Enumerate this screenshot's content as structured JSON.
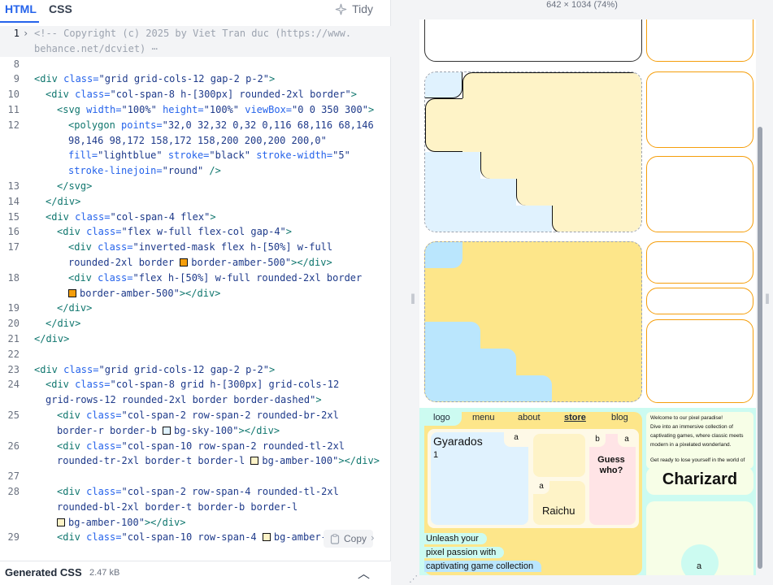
{
  "editor": {
    "tabs": {
      "html": "HTML",
      "css": "CSS"
    },
    "tidy_label": "Tidy",
    "copy_label": "Copy",
    "generated_css": {
      "title": "Generated CSS",
      "size": "2.47 kB"
    }
  },
  "code_lines": [
    {
      "num": "1",
      "fold": "›",
      "parts": [
        [
          "comment",
          "<!-- Copyright (c) 2025 by Viet Tran duc (https://www."
        ]
      ]
    },
    {
      "num": "",
      "parts": [
        [
          "comment",
          "behance.net/dcviet)"
        ],
        [
          "comment",
          " ⋯"
        ]
      ]
    },
    {
      "num": "8",
      "parts": []
    },
    {
      "num": "9",
      "parts": [
        [
          "tag",
          "<div "
        ],
        [
          "attr",
          "class="
        ],
        [
          "val",
          "\"grid grid-cols-12 gap-2 p-2\""
        ],
        [
          "tag",
          ">"
        ]
      ]
    },
    {
      "num": "10",
      "parts": [
        [
          "tag",
          "<div "
        ],
        [
          "attr",
          "class="
        ],
        [
          "val",
          "\"col-span-8 h-[300px] rounded-2xl border\""
        ],
        [
          "tag",
          ">"
        ]
      ]
    },
    {
      "num": "11",
      "parts": [
        [
          "tag",
          "<svg "
        ],
        [
          "attr",
          "width="
        ],
        [
          "val",
          "\"100%\" "
        ],
        [
          "attr",
          "height="
        ],
        [
          "val",
          "\"100%\" "
        ],
        [
          "attr",
          "viewBox="
        ],
        [
          "val",
          "\"0 0 350 300\""
        ],
        [
          "tag",
          ">"
        ]
      ]
    },
    {
      "num": "12",
      "parts": [
        [
          "tag",
          "<polygon "
        ],
        [
          "attr",
          "points="
        ],
        [
          "val",
          "\"32,0 32,32 0,32 0,116 68,116 68,146"
        ]
      ]
    },
    {
      "num": "",
      "parts": [
        [
          "val",
          "98,146 98,172 158,172 158,200 200,200 200,0\""
        ]
      ]
    },
    {
      "num": "",
      "parts": [
        [
          "attr",
          "fill="
        ],
        [
          "val",
          "\"lightblue\" "
        ],
        [
          "attr",
          "stroke="
        ],
        [
          "val",
          "\"black\" "
        ],
        [
          "attr",
          "stroke-width="
        ],
        [
          "val",
          "\"5\""
        ]
      ]
    },
    {
      "num": "",
      "parts": [
        [
          "attr",
          "stroke-linejoin="
        ],
        [
          "val",
          "\"round\" "
        ],
        [
          "tag",
          "/>"
        ]
      ]
    },
    {
      "num": "13",
      "parts": [
        [
          "tag",
          "</svg>"
        ]
      ]
    },
    {
      "num": "14",
      "parts": [
        [
          "tag",
          "</div>"
        ]
      ]
    },
    {
      "num": "15",
      "parts": [
        [
          "tag",
          "<div "
        ],
        [
          "attr",
          "class="
        ],
        [
          "val",
          "\"col-span-4 flex\""
        ],
        [
          "tag",
          ">"
        ]
      ]
    },
    {
      "num": "16",
      "parts": [
        [
          "tag",
          "<div "
        ],
        [
          "attr",
          "class="
        ],
        [
          "val",
          "\"flex w-full flex-col gap-4\""
        ],
        [
          "tag",
          ">"
        ]
      ]
    },
    {
      "num": "17",
      "parts": [
        [
          "tag",
          "<div "
        ],
        [
          "attr",
          "class="
        ],
        [
          "val",
          "\"inverted-mask flex h-[50%] w-full"
        ]
      ]
    },
    {
      "num": "",
      "parts": [
        [
          "val",
          "rounded-2xl border "
        ],
        [
          "swatch",
          "#f59e0b"
        ],
        [
          "val",
          "border-amber-500\""
        ],
        [
          "tag",
          "></div>"
        ]
      ]
    },
    {
      "num": "18",
      "parts": [
        [
          "tag",
          "<div "
        ],
        [
          "attr",
          "class="
        ],
        [
          "val",
          "\"flex h-[50%] w-full rounded-2xl border"
        ]
      ]
    },
    {
      "num": "",
      "parts": [
        [
          "swatch",
          "#f59e0b"
        ],
        [
          "val",
          "border-amber-500\""
        ],
        [
          "tag",
          "></div>"
        ]
      ]
    },
    {
      "num": "19",
      "parts": [
        [
          "tag",
          "</div>"
        ]
      ]
    },
    {
      "num": "20",
      "parts": [
        [
          "tag",
          "</div>"
        ]
      ]
    },
    {
      "num": "21",
      "parts": [
        [
          "tag",
          "</div>"
        ]
      ]
    },
    {
      "num": "22",
      "parts": []
    },
    {
      "num": "23",
      "parts": [
        [
          "tag",
          "<div "
        ],
        [
          "attr",
          "class="
        ],
        [
          "val",
          "\"grid grid-cols-12 gap-2 p-2\""
        ],
        [
          "tag",
          ">"
        ]
      ]
    },
    {
      "num": "24",
      "parts": [
        [
          "tag",
          "<div "
        ],
        [
          "attr",
          "class="
        ],
        [
          "val",
          "\"col-span-8 grid h-[300px] grid-cols-12"
        ]
      ]
    },
    {
      "num": "",
      "parts": [
        [
          "val",
          "grid-rows-12 rounded-2xl border border-dashed\""
        ],
        [
          "tag",
          ">"
        ]
      ]
    },
    {
      "num": "25",
      "parts": [
        [
          "tag",
          "<div "
        ],
        [
          "attr",
          "class="
        ],
        [
          "val",
          "\"col-span-2 row-span-2 rounded-br-2xl"
        ]
      ]
    },
    {
      "num": "",
      "parts": [
        [
          "val",
          "border-r border-b "
        ],
        [
          "swatch",
          "#e0f2fe"
        ],
        [
          "val",
          "bg-sky-100\""
        ],
        [
          "tag",
          "></div>"
        ]
      ]
    },
    {
      "num": "26",
      "parts": [
        [
          "tag",
          "<div "
        ],
        [
          "attr",
          "class="
        ],
        [
          "val",
          "\"col-span-10 row-span-2 rounded-tl-2xl"
        ]
      ]
    },
    {
      "num": "",
      "parts": [
        [
          "val",
          "rounded-tr-2xl border-t border-l "
        ],
        [
          "swatch",
          "#fef3c7"
        ],
        [
          "val",
          "bg-amber-100\""
        ],
        [
          "tag",
          "></div>"
        ]
      ]
    },
    {
      "num": "27",
      "parts": []
    },
    {
      "num": "28",
      "parts": [
        [
          "tag",
          "<div "
        ],
        [
          "attr",
          "class="
        ],
        [
          "val",
          "\"col-span-2 row-span-4 rounded-tl-2xl"
        ]
      ]
    },
    {
      "num": "",
      "parts": [
        [
          "val",
          "rounded-bl-2xl border-t border-b border-l"
        ]
      ]
    },
    {
      "num": "",
      "parts": [
        [
          "swatch",
          "#fef3c7"
        ],
        [
          "val",
          "bg-amber-100\""
        ],
        [
          "tag",
          "></div>"
        ]
      ]
    },
    {
      "num": "29",
      "parts": [
        [
          "tag",
          "<div "
        ],
        [
          "attr",
          "class="
        ],
        [
          "val",
          "\"col-span-10 row-span-4 "
        ],
        [
          "swatch",
          "#fef3c7"
        ],
        [
          "val",
          "bg-amber-1"
        ]
      ]
    }
  ],
  "preview": {
    "dims_label": "642 × 1034 (74%)",
    "nav": {
      "logo": "logo",
      "menu": "menu",
      "about": "about",
      "store": "store",
      "blog": "blog"
    },
    "card": {
      "title": "Gyarados",
      "number": "1",
      "badge_a": "a",
      "badge_b": "b",
      "guess": "Guess who?",
      "raichu": "Raichu"
    },
    "tagline": [
      "Unleash your",
      "pixel passion with",
      "captivating game collection"
    ],
    "welcome": [
      "Welcome to our pixel paradise!",
      "Dive into an immersive collection of",
      "captivating games, where classic meets",
      "modern in a pixelated wonderland."
    ],
    "ready": "Get ready to lose yourself in the world of",
    "charizard": "Charizard",
    "bottom_badge": "a"
  },
  "colors": {
    "accent": "#2563eb",
    "amber_border": "#f59e0b",
    "sky": "#e0f2fe",
    "amber_light": "#fef3c7",
    "amber_mid": "#fde68a",
    "sky_mid": "#bae6fd",
    "mint": "#ccfbf1"
  }
}
